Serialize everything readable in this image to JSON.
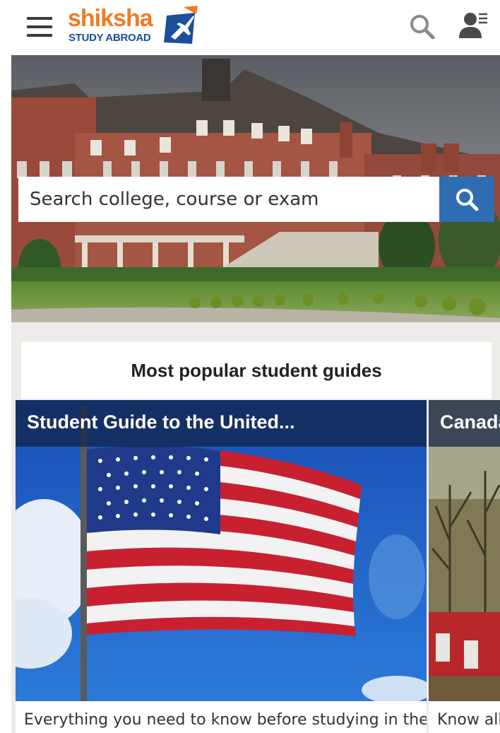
{
  "header": {
    "logo_text": "shiksha",
    "logo_subtext": "STUDY ABROAD",
    "icons": [
      "menu-icon",
      "search-icon",
      "user-menu-icon"
    ]
  },
  "hero": {
    "search_placeholder": "Search college, course or exam"
  },
  "guides": {
    "section_title": "Most popular student guides",
    "cards": [
      {
        "title": "Student Guide to the United...",
        "description": "Everything you need to know before studying in the"
      },
      {
        "title": "Canada",
        "description": "Know all"
      }
    ]
  },
  "colors": {
    "brand_orange": "#f47a20",
    "brand_blue": "#1b4f9c",
    "search_button": "#2f6db3",
    "section_background": "#edece8"
  }
}
